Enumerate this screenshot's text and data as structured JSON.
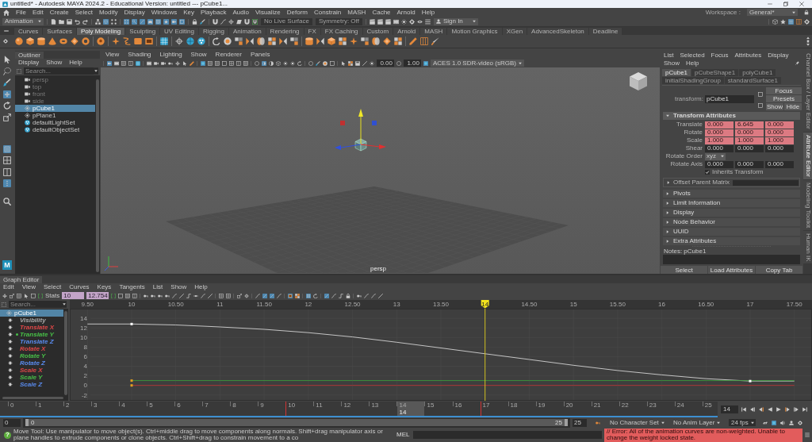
{
  "window": {
    "title": "untitled* - Autodesk MAYA 2024.2 - Educational Version: untitled --- pCube1..."
  },
  "menu_bar": {
    "items": [
      "File",
      "Edit",
      "Create",
      "Select",
      "Modify",
      "Display",
      "Windows",
      "Key",
      "Playback",
      "Audio",
      "Visualize",
      "Deform",
      "Constrain",
      "MASH",
      "Cache",
      "Arnold",
      "Help"
    ],
    "workspace_label": "Workspace :",
    "workspace": "General*"
  },
  "status_line": {
    "items": [
      {
        "kind": "dropdown",
        "text": "Animation"
      },
      {
        "kind": "icons",
        "buttons": [
          {
            "on": false
          },
          {
            "on": false
          },
          {
            "on": false
          },
          {
            "on": false
          },
          {
            "on": false
          }
        ]
      },
      {
        "kind": "icons",
        "buttons": [
          {
            "on": false
          },
          {
            "on": true
          },
          {
            "on": false
          }
        ]
      },
      {
        "kind": "icons",
        "buttons": [
          {
            "on": true
          },
          {
            "on": true
          },
          {
            "on": true
          },
          {
            "on": true
          },
          {
            "on": true
          },
          {
            "on": true
          },
          {
            "on": true
          },
          {
            "on": true
          }
        ]
      },
      {
        "kind": "icons",
        "buttons": [
          {
            "on": false
          },
          {
            "on": false
          }
        ]
      },
      {
        "kind": "icons",
        "buttons": [
          {
            "on": false
          },
          {
            "on": false
          },
          {
            "on": false
          },
          {
            "on": false
          },
          {
            "on": false
          },
          {
            "on": false
          }
        ]
      },
      {
        "kind": "field",
        "text": "No Live Surface"
      },
      {
        "kind": "field",
        "text": "Symmetry: Off"
      },
      {
        "kind": "icons",
        "buttons": [
          {
            "on": false
          },
          {
            "on": false
          },
          {
            "on": false
          },
          {
            "on": false
          },
          {
            "on": false
          },
          {
            "on": false
          },
          {
            "on": false
          },
          {
            "on": false
          }
        ]
      },
      {
        "kind": "account",
        "text": "Sign In"
      },
      {
        "kind": "icons",
        "buttons": [
          {
            "on": false
          },
          {
            "on": false
          },
          {
            "on": true
          },
          {
            "on": false
          },
          {
            "on": false
          }
        ]
      }
    ]
  },
  "shelf": {
    "tabs": [
      {
        "label": "Curves",
        "selected": false
      },
      {
        "label": "Surfaces",
        "selected": false
      },
      {
        "label": "Poly Modeling",
        "selected": true
      },
      {
        "label": "Sculpting",
        "selected": false
      },
      {
        "label": "UV Editing",
        "selected": false
      },
      {
        "label": "Rigging",
        "selected": false
      },
      {
        "label": "Animation",
        "selected": false
      },
      {
        "label": "Rendering",
        "selected": false
      },
      {
        "label": "FX",
        "selected": false
      },
      {
        "label": "FX Caching",
        "selected": false
      },
      {
        "label": "Custom",
        "selected": false
      },
      {
        "label": "Arnold",
        "selected": false
      },
      {
        "label": "MASH",
        "selected": false
      },
      {
        "label": "Motion Graphics",
        "selected": false
      },
      {
        "label": "XGen",
        "selected": false
      },
      {
        "label": "AdvancedSkeleton",
        "selected": false
      },
      {
        "label": "Deadline",
        "selected": false
      }
    ]
  },
  "toolbox": {
    "groups": [
      [
        {
          "on": false
        },
        {
          "on": false
        },
        {
          "on": false
        },
        {
          "on": true
        },
        {
          "on": false
        },
        {
          "on": false
        }
      ],
      [
        {
          "on": true
        },
        {
          "on": false
        },
        {
          "on": false
        },
        {
          "on": true
        }
      ],
      [
        {
          "on": false
        }
      ]
    ],
    "logo": "M"
  },
  "outliner": {
    "tab": "Outliner",
    "menu": [
      "Display",
      "Show",
      "Help"
    ],
    "search": {
      "placeholder": "Search..."
    },
    "items": [
      {
        "label": "persp",
        "kind": "camera",
        "dimmed": true,
        "selected": false
      },
      {
        "label": "top",
        "kind": "camera",
        "dimmed": true,
        "selected": false
      },
      {
        "label": "front",
        "kind": "camera",
        "dimmed": true,
        "selected": false
      },
      {
        "label": "side",
        "kind": "camera",
        "dimmed": true,
        "selected": false
      },
      {
        "label": "pCube1",
        "kind": "mesh",
        "dimmed": false,
        "selected": true
      },
      {
        "label": "pPlane1",
        "kind": "mesh",
        "dimmed": false,
        "selected": false
      },
      {
        "label": "defaultLightSet",
        "kind": "set",
        "dimmed": false,
        "selected": false
      },
      {
        "label": "defaultObjectSet",
        "kind": "set",
        "dimmed": false,
        "selected": false
      }
    ]
  },
  "viewport": {
    "menu": [
      "View",
      "Shading",
      "Lighting",
      "Show",
      "Renderer",
      "Panels"
    ],
    "toolbar": {
      "items": [
        {
          "kind": "icons",
          "buttons": [
            {
              "on": true
            },
            {
              "on": false
            },
            {
              "on": false
            },
            {
              "on": false
            },
            {
              "on": false
            }
          ]
        },
        {
          "kind": "icons",
          "buttons": [
            {
              "on": false
            },
            {
              "on": false
            },
            {
              "on": false
            },
            {
              "on": false
            },
            {
              "on": false
            },
            {
              "on": false
            },
            {
              "on": false
            }
          ]
        },
        {
          "kind": "icons",
          "buttons": [
            {
              "on": true
            },
            {
              "on": false
            },
            {
              "on": false
            },
            {
              "on": false
            },
            {
              "on": false
            },
            {
              "on": false
            },
            {
              "on": false
            }
          ]
        },
        {
          "kind": "icons",
          "buttons": [
            {
              "on": false
            },
            {
              "on": true
            },
            {
              "on": false
            },
            {
              "on": false
            },
            {
              "on": false
            },
            {
              "on": false
            },
            {
              "on": false
            }
          ]
        },
        {
          "kind": "icons",
          "buttons": [
            {
              "on": false
            },
            {
              "on": false
            },
            {
              "on": false
            },
            {
              "on": false
            }
          ]
        },
        {
          "kind": "icons",
          "buttons": [
            {
              "on": false
            },
            {
              "on": false
            },
            {
              "on": false
            },
            {
              "on": false
            }
          ]
        },
        {
          "kind": "icons",
          "buttons": [
            {
              "on": false
            }
          ]
        },
        {
          "kind": "field",
          "text": "0.00"
        },
        {
          "kind": "icons",
          "buttons": [
            {
              "on": false
            }
          ]
        },
        {
          "kind": "field",
          "text": "1.00"
        },
        {
          "kind": "icons",
          "buttons": [
            {
              "on": true
            }
          ]
        },
        {
          "kind": "dropdown",
          "text": "ACES 1.0 SDR-video (sRGB)"
        }
      ]
    },
    "camera": "persp"
  },
  "attribute_editor": {
    "menu": [
      "List",
      "Selected",
      "Focus",
      "Attributes",
      "Display",
      "Show",
      "Help"
    ],
    "tabs": [
      {
        "label": "pCube1",
        "selected": true
      },
      {
        "label": "pCubeShape1",
        "selected": false
      },
      {
        "label": "polyCube1",
        "selected": false
      },
      {
        "label": "initialShadingGroup",
        "selected": false
      },
      {
        "label": "standardSurface1",
        "selected": false
      }
    ],
    "node_type": "transform:",
    "node_name": "pCube1",
    "buttons": [
      "Focus",
      "Presets",
      "Show",
      "Hide"
    ],
    "sections": [
      {
        "label": "Transform Attributes",
        "expanded": true,
        "attributes": [
          {
            "kind": "vector",
            "label": "Translate",
            "values": [
              "0.000",
              "6.645",
              "0.000"
            ],
            "keyed": true
          },
          {
            "kind": "vector",
            "label": "Rotate",
            "values": [
              "0.000",
              "0.000",
              "0.000"
            ],
            "keyed": true
          },
          {
            "kind": "vector",
            "label": "Scale",
            "values": [
              "1.000",
              "1.000",
              "1.000"
            ],
            "keyed": true
          },
          {
            "kind": "vector",
            "label": "Shear",
            "values": [
              "0.000",
              "0.000",
              "0.000"
            ],
            "keyed": false
          },
          {
            "kind": "dropdown",
            "label": "Rotate Order",
            "value": "xyz"
          },
          {
            "kind": "vector",
            "label": "Rotate Axis",
            "values": [
              "0.000",
              "0.000",
              "0.000"
            ],
            "keyed": false
          },
          {
            "kind": "checkbox",
            "label": "Inherits Transform",
            "checked": true
          },
          {
            "kind": "subsection",
            "label": "Offset Parent Matrix",
            "expanded": false
          }
        ]
      },
      {
        "label": "Pivots",
        "expanded": false
      },
      {
        "label": "Limit Information",
        "expanded": false
      },
      {
        "label": "Display",
        "expanded": false
      },
      {
        "label": "Node Behavior",
        "expanded": false
      },
      {
        "label": "UUID",
        "expanded": false
      },
      {
        "label": "Extra Attributes",
        "expanded": false
      }
    ],
    "notes": "Notes: pCube1",
    "bottom_buttons": [
      "Select",
      "Load Attributes",
      "Copy Tab"
    ]
  },
  "side_tabs": [
    {
      "label": "Channel Box / Layer Editor",
      "selected": false
    },
    {
      "label": "Attribute Editor",
      "selected": true
    },
    {
      "label": "Modeling Toolkit",
      "selected": false
    },
    {
      "label": "Human IK",
      "selected": false
    }
  ],
  "graph_editor": {
    "title": "Graph Editor",
    "menu": [
      "Edit",
      "View",
      "Select",
      "Curves",
      "Keys",
      "Tangents",
      "List",
      "Show",
      "Help"
    ],
    "toolbar": {
      "items": [
        {
          "kind": "icons",
          "buttons": [
            {
              "on": false
            },
            {
              "on": false
            },
            {
              "on": false
            },
            {
              "on": false
            },
            {
              "on": false
            },
            {
              "on": false
            }
          ]
        },
        {
          "kind": "label",
          "text": "Stats"
        },
        {
          "kind": "stat",
          "text": "10"
        },
        {
          "kind": "stat",
          "text": "12.754"
        },
        {
          "kind": "icons",
          "buttons": [
            {
              "on": false
            },
            {
              "on": false
            },
            {
              "on": false
            },
            {
              "on": false
            }
          ]
        },
        {
          "kind": "icons",
          "buttons": [
            {
              "on": false
            },
            {
              "on": false
            },
            {
              "on": false
            },
            {
              "on": false
            },
            {
              "on": false
            },
            {
              "on": false
            },
            {
              "on": false
            },
            {
              "on": false
            },
            {
              "on": false
            },
            {
              "on": false
            }
          ]
        },
        {
          "kind": "icons",
          "buttons": [
            {
              "on": false
            },
            {
              "on": false
            }
          ]
        },
        {
          "kind": "icons",
          "buttons": [
            {
              "on": false
            },
            {
              "on": false
            }
          ]
        },
        {
          "kind": "icons",
          "buttons": [
            {
              "on": false
            },
            {
              "on": true
            },
            {
              "on": true
            },
            {
              "on": false
            }
          ]
        },
        {
          "kind": "icons",
          "buttons": [
            {
              "on": true
            },
            {
              "on": false
            }
          ]
        },
        {
          "kind": "icons",
          "buttons": [
            {
              "on": true
            },
            {
              "on": false
            }
          ]
        },
        {
          "kind": "icons",
          "buttons": [
            {
              "on": true
            },
            {
              "on": false
            },
            {
              "on": false
            },
            {
              "on": false
            }
          ]
        },
        {
          "kind": "icons",
          "buttons": [
            {
              "on": false
            },
            {
              "on": false
            },
            {
              "on": false
            },
            {
              "on": false
            }
          ]
        }
      ]
    },
    "search": {
      "placeholder": "Search..."
    },
    "node": {
      "label": "pCube1",
      "selected": true
    },
    "channels": [
      {
        "label": "Visibility",
        "color": "#a8a8a8",
        "selected": false
      },
      {
        "label": "Translate X",
        "color": "#e04848",
        "selected": false
      },
      {
        "label": "Translate Y",
        "color": "#48c048",
        "selected": true
      },
      {
        "label": "Translate Z",
        "color": "#5a8cf0",
        "selected": false
      },
      {
        "label": "Rotate X",
        "color": "#e04848",
        "selected": false
      },
      {
        "label": "Rotate Y",
        "color": "#48c048",
        "selected": false
      },
      {
        "label": "Rotate Z",
        "color": "#5a8cf0",
        "selected": false
      },
      {
        "label": "Scale X",
        "color": "#e04848",
        "selected": false
      },
      {
        "label": "Scale Y",
        "color": "#48c048",
        "selected": false
      },
      {
        "label": "Scale Z",
        "color": "#5a8cf0",
        "selected": false
      }
    ],
    "chart_data": {
      "type": "line",
      "x": [
        9.5,
        10,
        10.5,
        11,
        11.5,
        12,
        12.5,
        13,
        13.5,
        14,
        14.5,
        15,
        15.5,
        16,
        16.5,
        17,
        17.5
      ],
      "series": [
        {
          "color": "#d2d2d2",
          "values": [
            12.8,
            12.8,
            12.6,
            12.2,
            11.7,
            11.0,
            10.1,
            9.0,
            7.8,
            6.6,
            5.4,
            4.2,
            3.1,
            2.2,
            1.4,
            0.9,
            0.9
          ]
        },
        {
          "color": "#3c9c3c",
          "values": [
            null,
            1,
            1,
            1,
            1,
            1,
            1,
            1,
            1,
            1,
            1,
            1,
            1,
            1,
            1,
            1,
            1
          ]
        },
        {
          "color": "#b83434",
          "values": [
            null,
            0,
            0,
            0,
            0,
            0,
            0,
            0,
            0,
            0,
            0,
            0,
            0,
            0,
            0,
            0,
            0
          ]
        }
      ],
      "xlim": [
        9.3,
        17.7
      ],
      "ylim": [
        -3.2,
        16
      ],
      "xticks": [
        {
          "value": 9.5,
          "label": "9.50"
        },
        10,
        {
          "value": 10.5,
          "label": "10.50"
        },
        11,
        {
          "value": 11.5,
          "label": "11.50"
        },
        12,
        {
          "value": 12.5,
          "label": "12.50"
        },
        13,
        {
          "value": 13.5,
          "label": "13.50"
        },
        {
          "value": 14.5,
          "label": "14.50"
        },
        15,
        {
          "value": 15.5,
          "label": "15.50"
        },
        16,
        {
          "value": 16.5,
          "label": "16.50"
        },
        17,
        {
          "value": 17.5,
          "label": "17.50"
        }
      ],
      "yticks": [
        -2,
        0,
        2,
        4,
        6,
        8,
        10,
        12,
        14
      ],
      "grid": true,
      "ref_lines": [
        {
          "axis": "x",
          "value": 14,
          "label": "14"
        }
      ]
    }
  },
  "timeline": {
    "frames": [
      {
        "label": "0",
        "key": false,
        "selected": false
      },
      {
        "label": "1",
        "key": false,
        "selected": false
      },
      {
        "label": "2",
        "key": false,
        "selected": false
      },
      {
        "label": "3",
        "key": false,
        "selected": false
      },
      {
        "label": "4",
        "key": false,
        "selected": false
      },
      {
        "label": "5",
        "key": false,
        "selected": false
      },
      {
        "label": "6",
        "key": false,
        "selected": false
      },
      {
        "label": "7",
        "key": false,
        "selected": false
      },
      {
        "label": "8",
        "key": false,
        "selected": false
      },
      {
        "label": "9",
        "key": false,
        "selected": false
      },
      {
        "label": "10",
        "key": true,
        "selected": false
      },
      {
        "label": "11",
        "key": false,
        "selected": false
      },
      {
        "label": "12",
        "key": false,
        "selected": false
      },
      {
        "label": "13",
        "key": false,
        "selected": false
      },
      {
        "label": "14",
        "key": false,
        "selected": true
      },
      {
        "label": "15",
        "key": false,
        "selected": false
      },
      {
        "label": "16",
        "key": false,
        "selected": false
      },
      {
        "label": "17",
        "key": true,
        "selected": false
      },
      {
        "label": "18",
        "key": false,
        "selected": false
      },
      {
        "label": "19",
        "key": false,
        "selected": false
      },
      {
        "label": "20",
        "key": false,
        "selected": false
      },
      {
        "label": "21",
        "key": false,
        "selected": false
      },
      {
        "label": "22",
        "key": false,
        "selected": false
      },
      {
        "label": "23",
        "key": false,
        "selected": false
      },
      {
        "label": "24",
        "key": false,
        "selected": false
      },
      {
        "label": "25",
        "key": false,
        "selected": false
      }
    ],
    "current_frame": "14",
    "current_field": "14"
  },
  "range": {
    "start": "0",
    "range_start": "0",
    "range_end": "25",
    "end": "25",
    "level": 1,
    "character_set": "No Character Set",
    "anim_layer": "No Anim Layer",
    "fps": "24 fps",
    "buttons": [
      {
        "on": false
      },
      {
        "on": true
      },
      {
        "on": false
      },
      {
        "on": false
      },
      {
        "on": false
      }
    ]
  },
  "help_line": {
    "icon": "?",
    "text": "Move Tool: Use manipulator to move object(s). Ctrl+middle drag to move components along normals. Shift+drag manipulator axis or plane handles to extrude components or clone objects. Ctrl+Shift+drag to constrain movement to a co",
    "mel": "MEL",
    "error": "// Error: All of the animation curves are non-weighted. Unable to change the weight locked state."
  }
}
